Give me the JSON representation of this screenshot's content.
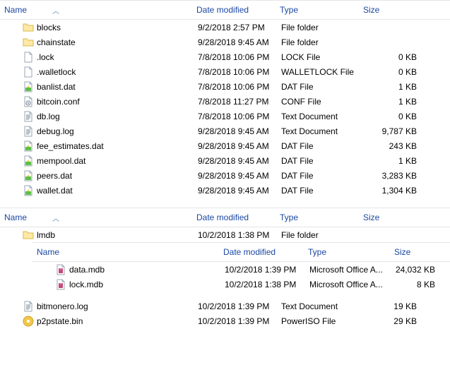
{
  "columns": {
    "name": "Name",
    "date": "Date modified",
    "type": "Type",
    "size": "Size"
  },
  "pane1": {
    "rows": [
      {
        "icon": "folder",
        "name": "blocks",
        "date": "9/2/2018 2:57 PM",
        "type": "File folder",
        "size": ""
      },
      {
        "icon": "folder",
        "name": "chainstate",
        "date": "9/28/2018 9:45 AM",
        "type": "File folder",
        "size": ""
      },
      {
        "icon": "file",
        "name": ".lock",
        "date": "7/8/2018 10:06 PM",
        "type": "LOCK File",
        "size": "0 KB"
      },
      {
        "icon": "file",
        "name": ".walletlock",
        "date": "7/8/2018 10:06 PM",
        "type": "WALLETLOCK File",
        "size": "0 KB"
      },
      {
        "icon": "dat",
        "name": "banlist.dat",
        "date": "7/8/2018 10:06 PM",
        "type": "DAT File",
        "size": "1 KB"
      },
      {
        "icon": "conf",
        "name": "bitcoin.conf",
        "date": "7/8/2018 11:27 PM",
        "type": "CONF File",
        "size": "1 KB"
      },
      {
        "icon": "text",
        "name": "db.log",
        "date": "7/8/2018 10:06 PM",
        "type": "Text Document",
        "size": "0 KB"
      },
      {
        "icon": "text",
        "name": "debug.log",
        "date": "9/28/2018 9:45 AM",
        "type": "Text Document",
        "size": "9,787 KB"
      },
      {
        "icon": "dat",
        "name": "fee_estimates.dat",
        "date": "9/28/2018 9:45 AM",
        "type": "DAT File",
        "size": "243 KB"
      },
      {
        "icon": "dat",
        "name": "mempool.dat",
        "date": "9/28/2018 9:45 AM",
        "type": "DAT File",
        "size": "1 KB"
      },
      {
        "icon": "dat",
        "name": "peers.dat",
        "date": "9/28/2018 9:45 AM",
        "type": "DAT File",
        "size": "3,283 KB"
      },
      {
        "icon": "dat",
        "name": "wallet.dat",
        "date": "9/28/2018 9:45 AM",
        "type": "DAT File",
        "size": "1,304 KB"
      }
    ]
  },
  "pane2": {
    "folder": {
      "icon": "folder",
      "name": "lmdb",
      "date": "10/2/2018 1:38 PM",
      "type": "File folder",
      "size": ""
    },
    "nested_rows": [
      {
        "icon": "mdb",
        "name": "data.mdb",
        "date": "10/2/2018 1:39 PM",
        "type": "Microsoft Office A...",
        "size": "24,032 KB"
      },
      {
        "icon": "mdb",
        "name": "lock.mdb",
        "date": "10/2/2018 1:38 PM",
        "type": "Microsoft Office A...",
        "size": "8 KB"
      }
    ],
    "rows_after": [
      {
        "icon": "text",
        "name": "bitmonero.log",
        "date": "10/2/2018 1:39 PM",
        "type": "Text Document",
        "size": "19 KB"
      },
      {
        "icon": "poweriso",
        "name": "p2pstate.bin",
        "date": "10/2/2018 1:39 PM",
        "type": "PowerISO File",
        "size": "29 KB"
      }
    ]
  }
}
